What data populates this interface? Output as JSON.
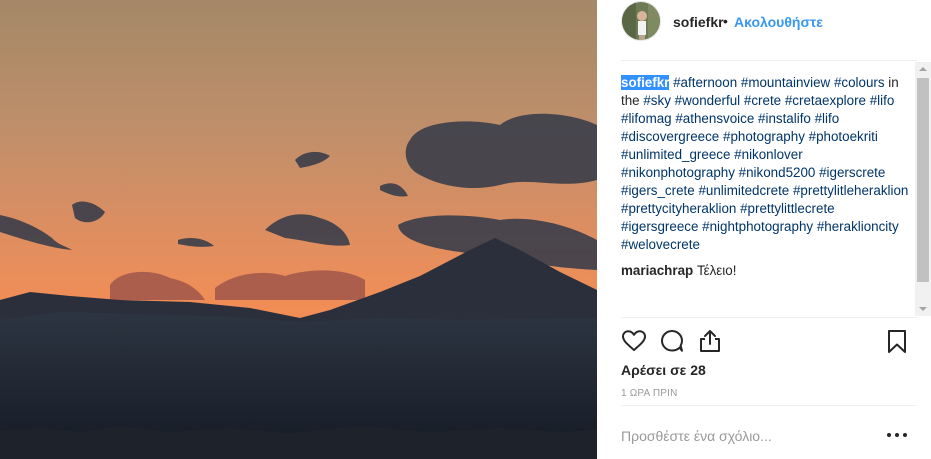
{
  "post": {
    "username": "sofiefkr",
    "separator": "•",
    "follow_label": "Ακολουθήστε",
    "caption_words": [
      {
        "t": "#afternoon",
        "tag": true
      },
      {
        "t": "#mountainview",
        "tag": true
      },
      {
        "t": "#colours",
        "tag": true
      },
      {
        "t": "in the",
        "tag": false
      },
      {
        "t": "#sky",
        "tag": true
      },
      {
        "t": "#wonderful",
        "tag": true
      },
      {
        "t": "#crete",
        "tag": true
      },
      {
        "t": "#cretaexplore",
        "tag": true
      },
      {
        "t": "#lifo",
        "tag": true
      },
      {
        "t": "#lifomag",
        "tag": true
      },
      {
        "t": "#athensvoice",
        "tag": true
      },
      {
        "t": "#instalifo",
        "tag": true
      },
      {
        "t": "#lifo",
        "tag": true
      },
      {
        "t": "#discovergreece",
        "tag": true
      },
      {
        "t": "#photography",
        "tag": true
      },
      {
        "t": "#photoekriti",
        "tag": true
      },
      {
        "t": "#unlimited_greece",
        "tag": true
      },
      {
        "t": "#nikonlover",
        "tag": true
      },
      {
        "t": "#nikonphotography",
        "tag": true
      },
      {
        "t": "#nikond5200",
        "tag": true
      },
      {
        "t": "#igerscrete",
        "tag": true
      },
      {
        "t": "#igers_crete",
        "tag": true
      },
      {
        "t": "#unlimitedcrete",
        "tag": true
      },
      {
        "t": "#prettylitleheraklion",
        "tag": true
      },
      {
        "t": "#prettycityheraklion",
        "tag": true
      },
      {
        "t": "#prettylittlecrete",
        "tag": true
      },
      {
        "t": "#igersgreece",
        "tag": true
      },
      {
        "t": "#nightphotography",
        "tag": true
      },
      {
        "t": "#heraklioncity",
        "tag": true
      },
      {
        "t": "#welovecrete",
        "tag": true
      }
    ],
    "comments": [
      {
        "user": "mariachrap",
        "text": "Τέλειο!"
      }
    ],
    "likes_text": "Αρέσει σε 28",
    "timestamp": "1 ΩΡΑ ΠΡΙΝ",
    "add_comment_placeholder": "Προσθέστε ένα σχόλιο...",
    "icons": [
      "heart-icon",
      "comment-icon",
      "share-icon",
      "bookmark-icon",
      "more-options-icon"
    ]
  },
  "colors": {
    "link": "#3897f0",
    "hashtag": "#003569",
    "selection": "#3390ff",
    "text": "#262626",
    "muted": "#999999"
  }
}
